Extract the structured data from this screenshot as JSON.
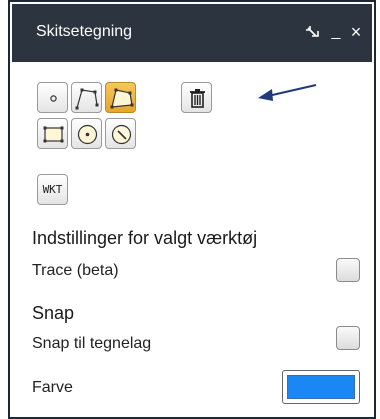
{
  "window": {
    "title": "Skitsetegning",
    "restore_glyph": "ꟹ",
    "minimize_glyph": "_",
    "close_glyph": "×"
  },
  "tools": {
    "wkt_label": "WKT",
    "active_tool": "polygon"
  },
  "settings": {
    "heading": "Indstillinger for valgt værktøj",
    "trace_label": "Trace (beta)",
    "trace_checked": false
  },
  "snap": {
    "heading": "Snap",
    "snap_label": "Snap til tegnelag",
    "snap_checked": false
  },
  "color": {
    "label": "Farve",
    "value": "#1a87f5"
  },
  "colors": {
    "titlebar": "#2c3440",
    "active_tool": "#f0b640",
    "arrow": "#1f3a7a"
  }
}
